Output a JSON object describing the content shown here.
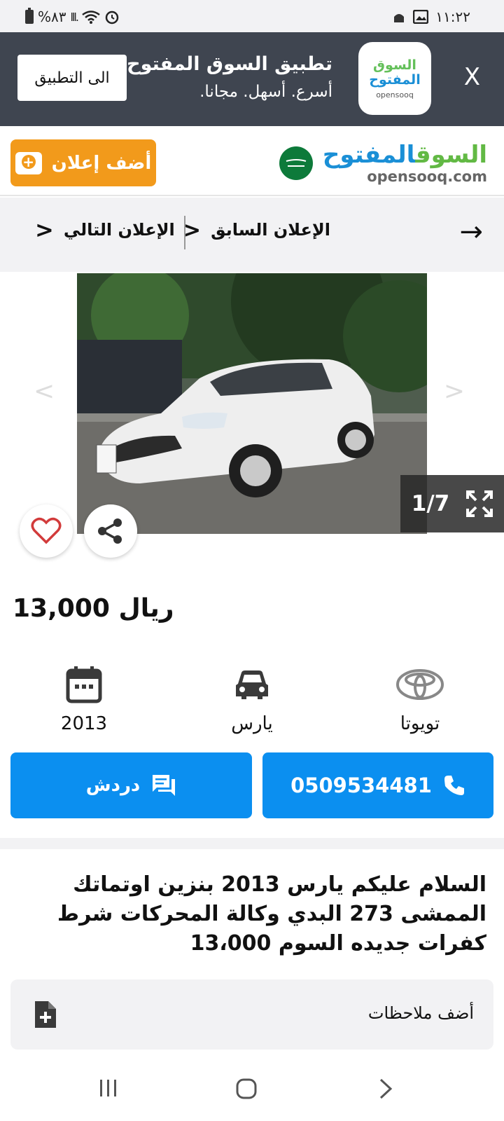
{
  "status_bar": {
    "time": "١١:٢٢",
    "battery": "%٨٣",
    "icons": [
      "battery-icon",
      "signal-icon",
      "wifi-icon",
      "alarm-icon",
      "gallery-icon",
      "mosque-icon"
    ]
  },
  "app_banner": {
    "open_label": "الى التطبيق",
    "title": "تطبيق السوق المفتوح",
    "subtitle": "أسرع. أسهل. مجانا.",
    "logo_line1": "السوق",
    "logo_line2": "المفتوح",
    "logo_line3": "opensooq",
    "close_label": "X"
  },
  "header": {
    "post_ad_label": "أضف إعلان",
    "brand_green": "السوق",
    "brand_blue": "المفتوح",
    "brand_en": "opensooq.com"
  },
  "ad_nav": {
    "previous_label": "الإعلان السابق",
    "next_label": "الإعلان التالي"
  },
  "gallery": {
    "counter": "1/7",
    "plate": "ب ل ط"
  },
  "listing": {
    "price": "13,000",
    "currency": "ريال",
    "year": "2013",
    "model": "يارس",
    "make": "تويوتا",
    "phone": "0509534481",
    "chat_label": "دردش",
    "description": "السلام عليكم يارس 2013 بنزين اوتماتك الممشى 273 البدي وكالة المحركات شرط كفرات جديده السوم 13،000",
    "add_notes_label": "أضف ملاحظات"
  },
  "colors": {
    "accent_orange": "#f29a1b",
    "primary_blue": "#0b8ff0",
    "banner_bg": "#3f4550",
    "brand_green": "#62b944",
    "brand_blue": "#1a8fd6"
  }
}
